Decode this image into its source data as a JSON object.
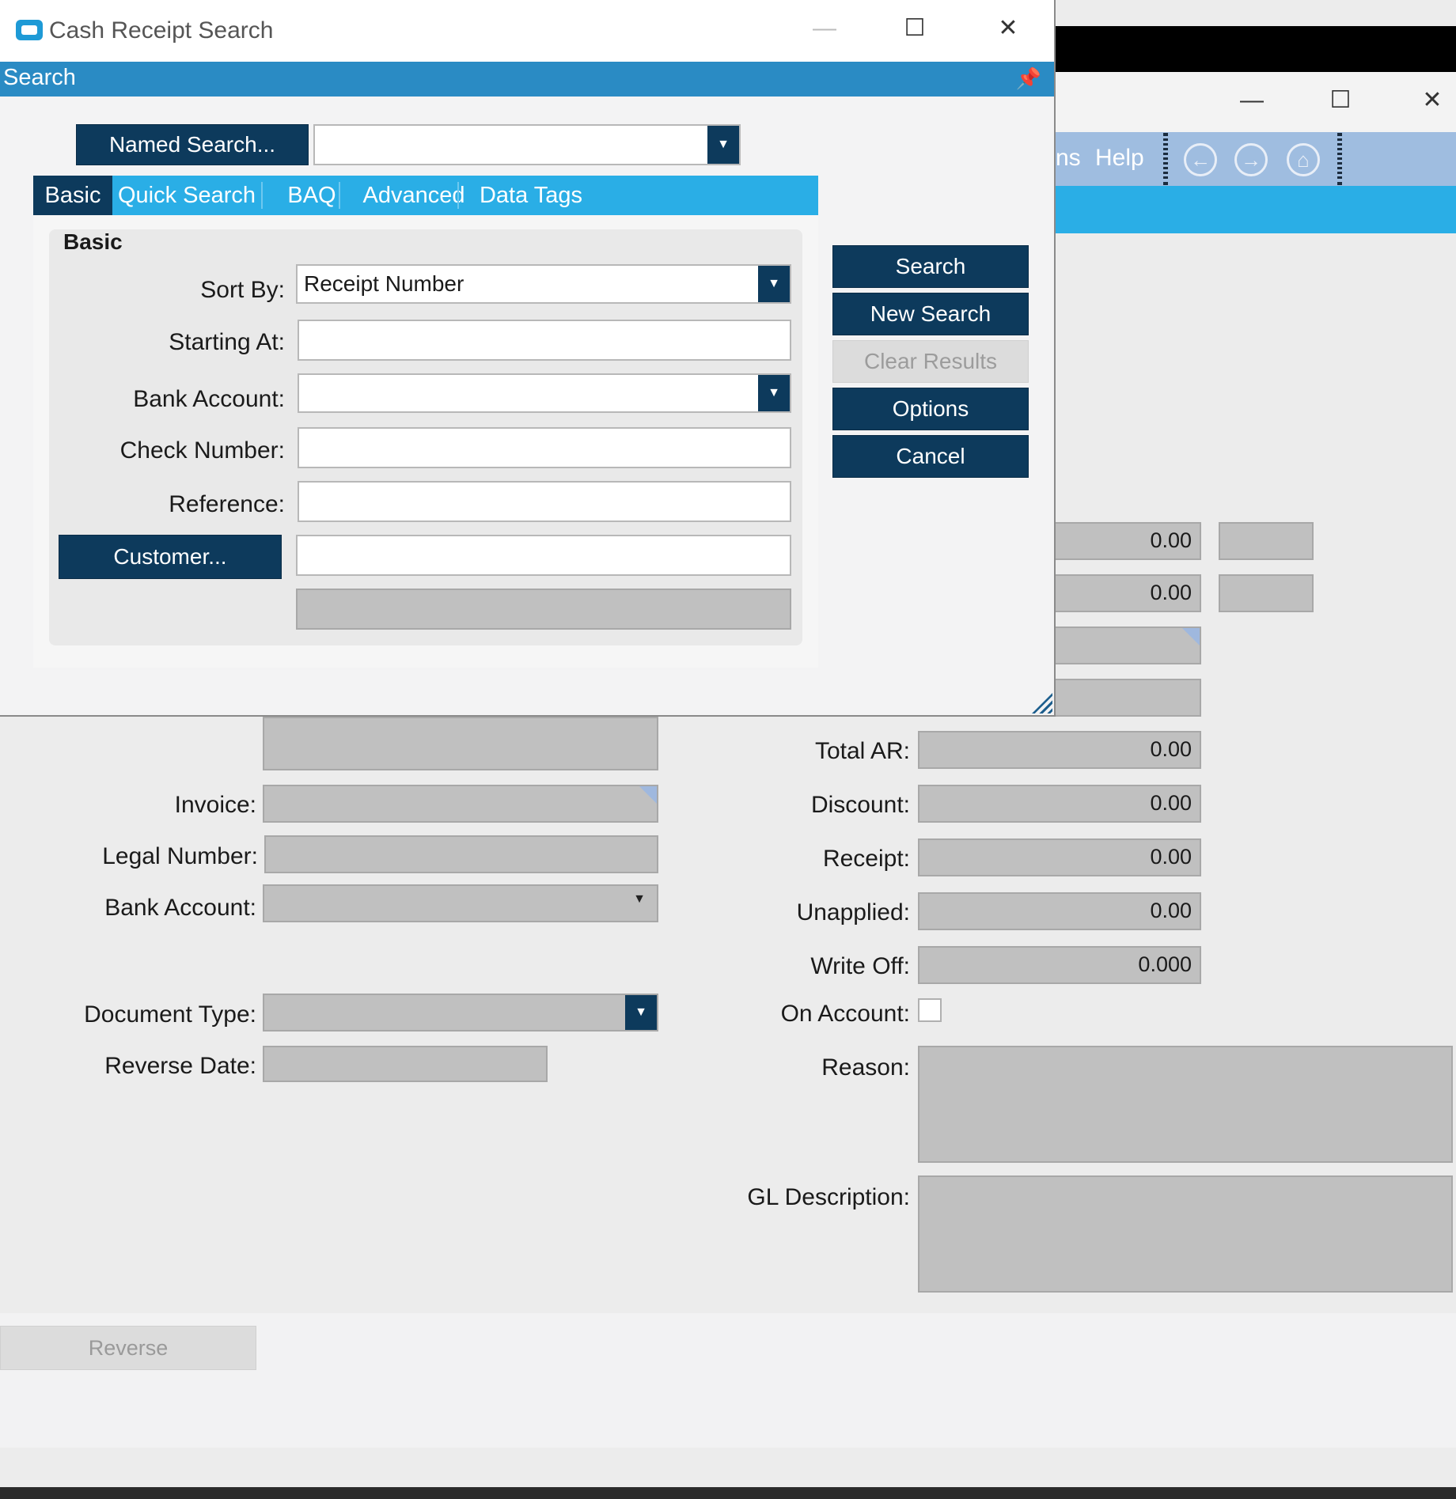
{
  "dialog": {
    "title": "Cash Receipt Search",
    "header": "Search",
    "named_search_label": "Named Search...",
    "named_search_value": "",
    "tabs": [
      {
        "label": "Basic",
        "active": true
      },
      {
        "label": "Quick Search",
        "active": false
      },
      {
        "label": "BAQ",
        "active": false
      },
      {
        "label": "Advanced",
        "active": false
      },
      {
        "label": "Data Tags",
        "active": false
      }
    ],
    "group_title": "Basic",
    "fields": {
      "sort_by_label": "Sort By:",
      "sort_by_value": "Receipt Number",
      "starting_at_label": "Starting At:",
      "bank_account_label": "Bank Account:",
      "check_number_label": "Check Number:",
      "reference_label": "Reference:",
      "customer_button": "Customer..."
    },
    "buttons": {
      "search": "Search",
      "new_search": "New Search",
      "clear_results": "Clear Results",
      "options": "Options",
      "cancel": "Cancel"
    }
  },
  "background_app": {
    "menu": {
      "partial_item": "ns",
      "help": "Help"
    },
    "right_fields": {
      "row1_value": "0.00",
      "row2_value": "0.00",
      "total_ar_label": "Total AR:",
      "total_ar": "0.00",
      "discount_label": "Discount:",
      "discount": "0.00",
      "receipt_label": "Receipt:",
      "receipt": "0.00",
      "unapplied_label": "Unapplied:",
      "unapplied": "0.00",
      "write_off_label": "Write Off:",
      "write_off": "0.000",
      "on_account_label": "On Account:",
      "reason_label": "Reason:",
      "gl_description_label": "GL Description:"
    },
    "left_fields": {
      "invoice_label": "Invoice:",
      "legal_number_label": "Legal Number:",
      "bank_account_label": "Bank Account:",
      "document_type_label": "Document Type:",
      "reverse_date_label": "Reverse Date:"
    },
    "reverse_button": "Reverse"
  },
  "colors": {
    "navy": "#0d3a5c",
    "header_blue": "#2a8bc4",
    "tab_blue": "#2aaee6",
    "menu_blue": "#9fbde0",
    "readonly_gray": "#c0c0c0"
  }
}
